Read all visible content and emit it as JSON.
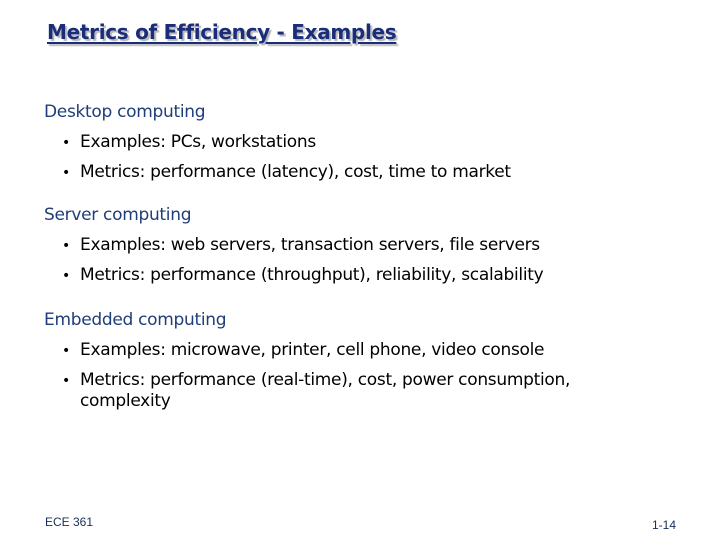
{
  "slide": {
    "title": "Metrics of Efficiency - Examples",
    "sections": [
      {
        "heading": "Desktop computing",
        "bullets": [
          "Examples: PCs, workstations",
          "Metrics: performance (latency), cost, time to market"
        ]
      },
      {
        "heading": "Server computing",
        "bullets": [
          "Examples: web servers, transaction servers, file servers",
          "Metrics: performance (throughput), reliability, scalability"
        ]
      },
      {
        "heading": "Embedded computing",
        "bullets": [
          "Examples: microwave, printer, cell phone, video console",
          "Metrics: performance (real-time), cost, power consumption, complexity"
        ]
      }
    ],
    "footer": {
      "course": "ECE 361",
      "page": "1-14"
    },
    "bullet_glyph": "•"
  }
}
